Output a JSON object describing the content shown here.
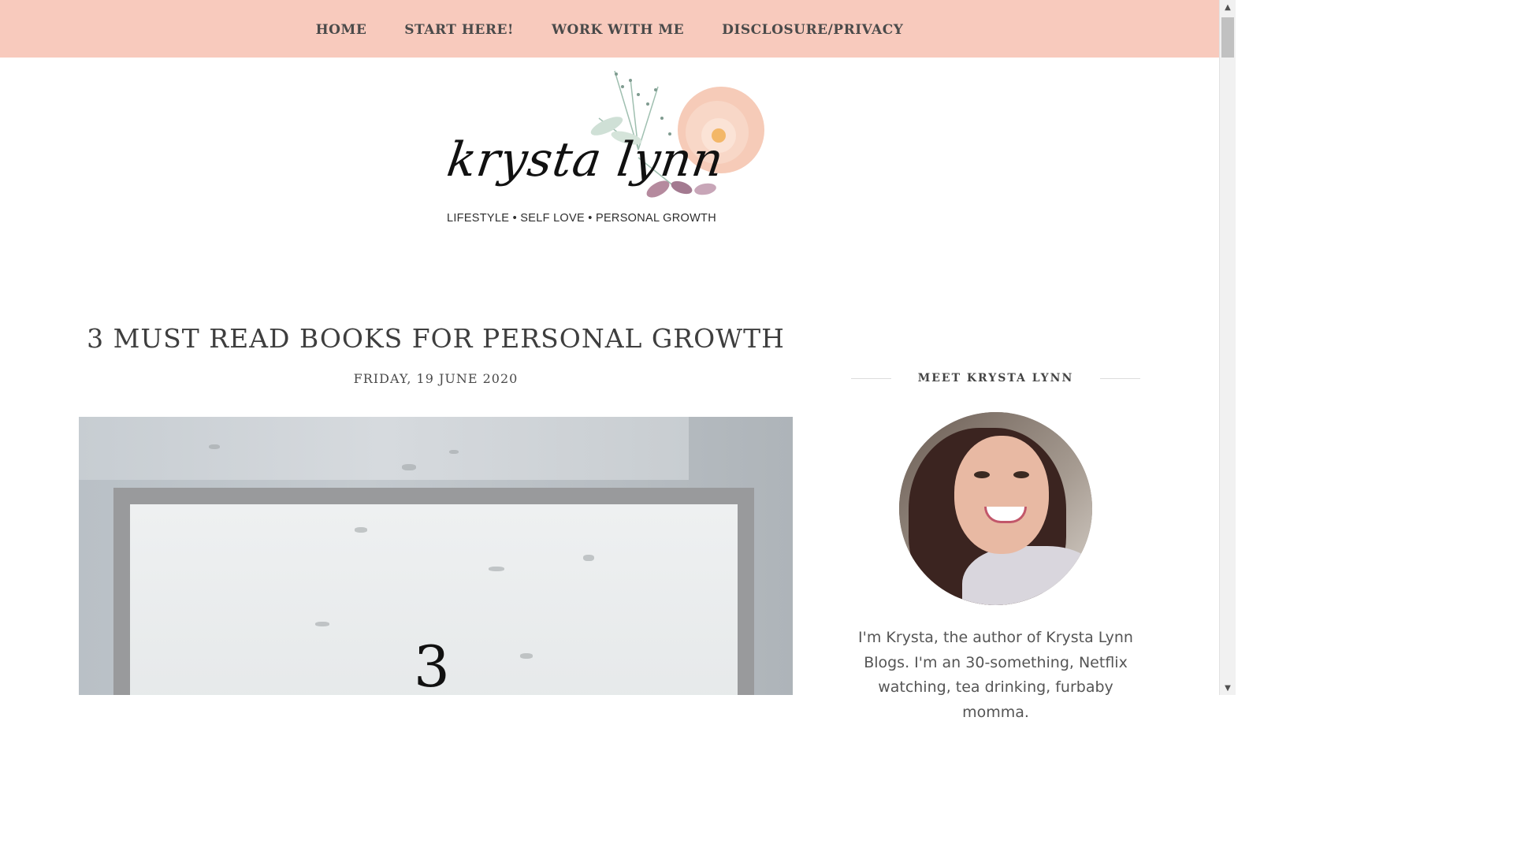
{
  "nav": {
    "items": [
      {
        "label": "HOME"
      },
      {
        "label": "START HERE!"
      },
      {
        "label": "WORK WITH ME"
      },
      {
        "label": "DISCLOSURE/PRIVACY"
      }
    ]
  },
  "header": {
    "logo_script": "krysta lynn",
    "tagline": "LIFESTYLE • SELF LOVE • PERSONAL GROWTH"
  },
  "post": {
    "title": "3 MUST READ BOOKS FOR PERSONAL GROWTH",
    "date": "FRIDAY, 19 JUNE 2020",
    "image_numeral": "3"
  },
  "sidebar": {
    "widget_title": "MEET KRYSTA LYNN",
    "bio": "I'm Krysta, the author of Krysta Lynn Blogs. I'm an 30-something, Netflix watching, tea drinking, furbaby momma."
  },
  "colors": {
    "nav_bg": "#f8cabd",
    "text": "#3e3e3e"
  }
}
